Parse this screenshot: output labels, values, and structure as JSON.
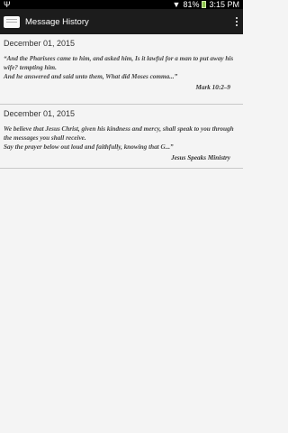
{
  "status": {
    "left_icon": "usb-icon",
    "battery": "81%",
    "time": "3:15 PM"
  },
  "header": {
    "title": "Message History"
  },
  "messages": [
    {
      "date": "December 01, 2015",
      "text": "“And the Pharisees came to him, and asked him, Is it lawful for a man to put away his wife? tempting him.\n And he answered and said unto them, What did Moses comma...”",
      "source": "Mark 10:2–9"
    },
    {
      "date": "December 01, 2015",
      "text": "We believe that Jesus Christ, given his kindness and mercy, shall speak to you through the messages you shall receive.\n Say the prayer below out loud and faithfully, knowing that G...”",
      "source": "Jesus Speaks Ministry"
    }
  ]
}
